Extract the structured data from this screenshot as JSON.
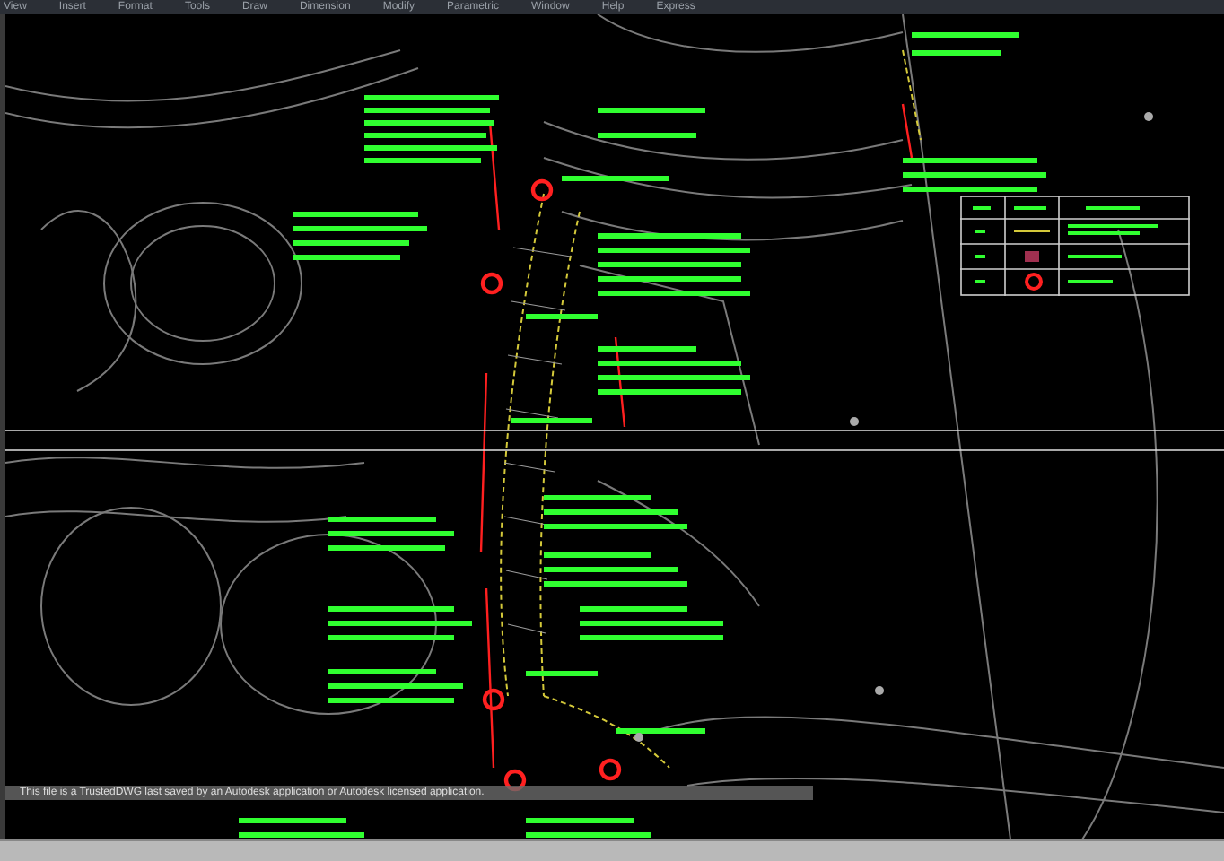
{
  "menu_bar": {
    "items": [
      "View",
      "Insert",
      "Format",
      "Tools",
      "Draw",
      "Dimension",
      "Modify",
      "Parametric",
      "Window",
      "Help",
      "Express"
    ]
  },
  "drawing_area": {
    "file_message": "This file is a TrustedDWG last saved by an Autodesk application or Autodesk licensed application."
  }
}
